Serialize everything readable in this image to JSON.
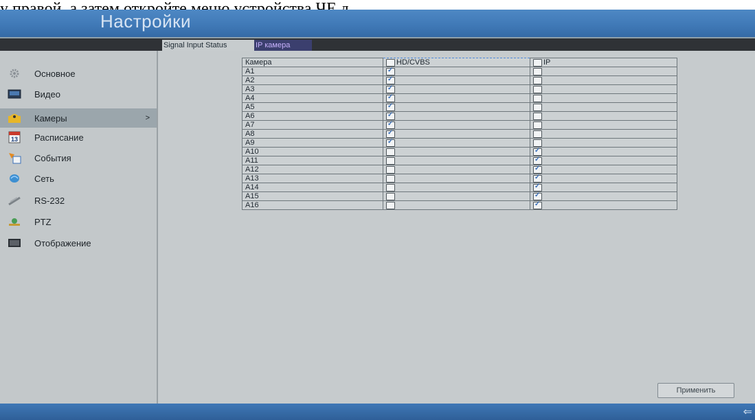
{
  "doc_text": "у правой, а затем откройте меню устройства ЧЕ д",
  "window": {
    "title": "Настройки"
  },
  "tabs": [
    {
      "label": "Signal Input Status",
      "active": true
    },
    {
      "label": "IP камера",
      "active": false
    }
  ],
  "sidebar": {
    "items": [
      {
        "label": "Основное",
        "icon": "gear-icon",
        "active": false
      },
      {
        "label": "Видео",
        "icon": "video-icon",
        "active": false
      },
      {
        "label": "Камеры",
        "icon": "camera-icon",
        "active": true,
        "arrow": ">"
      },
      {
        "label": "Расписание",
        "icon": "calendar-icon",
        "active": false,
        "icon_text": "13"
      },
      {
        "label": "События",
        "icon": "event-icon",
        "active": false
      },
      {
        "label": "Сеть",
        "icon": "network-icon",
        "active": false
      },
      {
        "label": "RS-232",
        "icon": "rs232-icon",
        "active": false
      },
      {
        "label": "PTZ",
        "icon": "ptz-icon",
        "active": false
      },
      {
        "label": "Отображение",
        "icon": "display-icon",
        "active": false
      }
    ]
  },
  "table": {
    "headers": [
      "Камера",
      "HD/CVBS",
      "IP"
    ],
    "rows": [
      {
        "camera": "A1",
        "hd": true,
        "ip": false
      },
      {
        "camera": "A2",
        "hd": true,
        "ip": false
      },
      {
        "camera": "A3",
        "hd": true,
        "ip": false
      },
      {
        "camera": "A4",
        "hd": true,
        "ip": false
      },
      {
        "camera": "A5",
        "hd": true,
        "ip": false
      },
      {
        "camera": "A6",
        "hd": true,
        "ip": false
      },
      {
        "camera": "A7",
        "hd": true,
        "ip": false
      },
      {
        "camera": "A8",
        "hd": true,
        "ip": false
      },
      {
        "camera": "A9",
        "hd": true,
        "ip": false
      },
      {
        "camera": "A10",
        "hd": false,
        "ip": true
      },
      {
        "camera": "A11",
        "hd": false,
        "ip": true
      },
      {
        "camera": "A12",
        "hd": false,
        "ip": true
      },
      {
        "camera": "A13",
        "hd": false,
        "ip": true
      },
      {
        "camera": "A14",
        "hd": false,
        "ip": true
      },
      {
        "camera": "A15",
        "hd": false,
        "ip": true
      },
      {
        "camera": "A16",
        "hd": false,
        "ip": true
      }
    ]
  },
  "buttons": {
    "apply": "Применить"
  },
  "colors": {
    "titlebar": "#3f78b6",
    "sidebar": "#c3c8ca",
    "active_item": "#9ba6ac",
    "check": "#3a6fb8"
  }
}
